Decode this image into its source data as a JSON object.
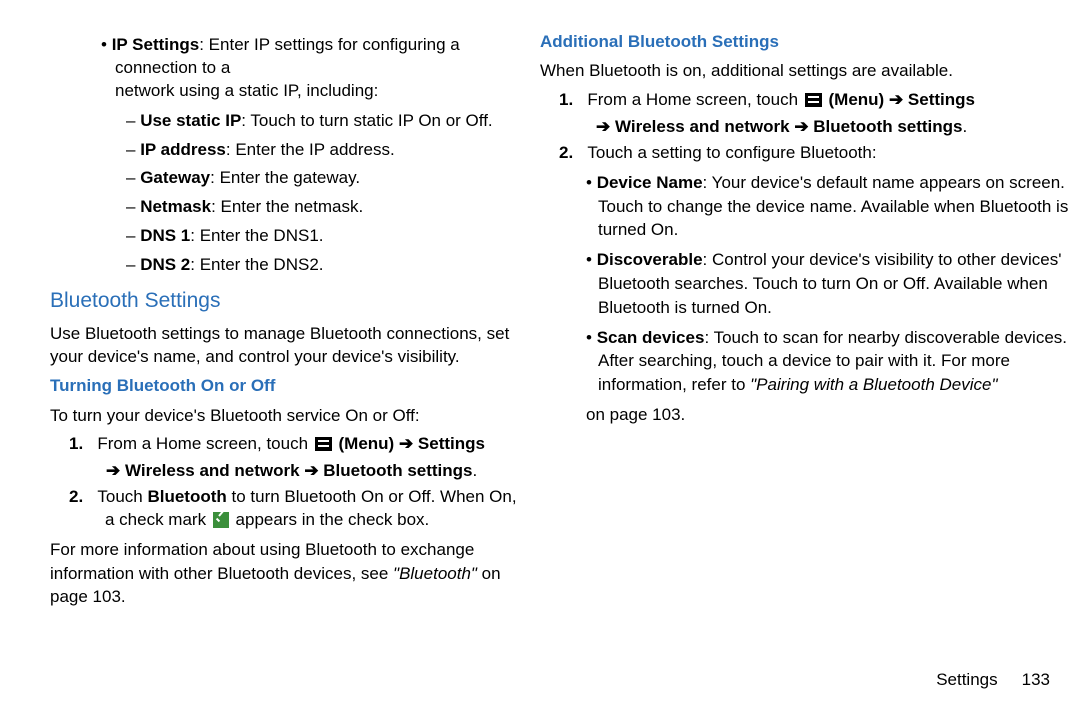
{
  "left": {
    "ip": {
      "title": "IP Settings",
      "intro1": ": Enter IP settings for configuring a connection to a ",
      "intro2": "network using a static IP, including:",
      "items": [
        {
          "label": "Use static IP",
          "desc": ": Touch to turn static IP On or Off."
        },
        {
          "label": "IP address",
          "desc": ": Enter the IP address."
        },
        {
          "label": "Gateway",
          "desc": ": Enter the gateway."
        },
        {
          "label": "Netmask",
          "desc": ": Enter the netmask."
        },
        {
          "label": "DNS 1",
          "desc": ": Enter the DNS1."
        },
        {
          "label": "DNS 2",
          "desc": ": Enter the DNS2."
        }
      ]
    },
    "bluetooth_heading": "Bluetooth Settings",
    "bluetooth_intro": "Use Bluetooth settings to manage Bluetooth connections, set your device's name, and control your device's visibility.",
    "turning_heading": "Turning Bluetooth On or Off",
    "turning_intro": "To turn your device's Bluetooth service On or Off:",
    "step1": {
      "num": "1.",
      "a": "From a Home screen, touch ",
      "menu": " (Menu) ",
      "arrow": "➔",
      "settings": " Settings",
      "cont": "➔ Wireless and network ➔ Bluetooth settings",
      "period": "."
    },
    "step2": {
      "num": "2.",
      "a": "Touch ",
      "b": "Bluetooth",
      "c": " to turn Bluetooth On or Off. When On, a check mark ",
      "d": " appears in the check box."
    },
    "more_a": "For more information about using Bluetooth to exchange information with other Bluetooth devices, see ",
    "more_italic": "\"Bluetooth\"",
    "more_b": " on page 103."
  },
  "right": {
    "addl_heading": "Additional Bluetooth Settings",
    "addl_intro": "When Bluetooth is on, additional settings are available.",
    "step1": {
      "num": "1.",
      "a": "From a Home screen, touch ",
      "menu": " (Menu) ",
      "arrow": "➔",
      "settings": " Settings",
      "cont": "➔ Wireless and network ➔ Bluetooth settings",
      "period": "."
    },
    "step2": {
      "num": "2.",
      "text": "Touch a setting to configure Bluetooth:"
    },
    "bullets": {
      "device_label": "Device Name",
      "device_text": ": Your device's default name appears on screen. Touch to change the device name. Available when Bluetooth is turned On.",
      "disc_label": "Discoverable",
      "disc_text": ": Control your device's visibility to other devices' Bluetooth searches. Touch to turn On or Off. Available when Bluetooth is turned On.",
      "scan_label": "Scan devices",
      "scan_text_a": ": Touch to scan for nearby discoverable devices. After searching, touch a device to pair with it. For more information, refer to ",
      "scan_italic": "\"Pairing with a Bluetooth Device\"",
      "scan_text_b": " on page 103."
    }
  },
  "footer": {
    "section": "Settings",
    "page": "133"
  }
}
